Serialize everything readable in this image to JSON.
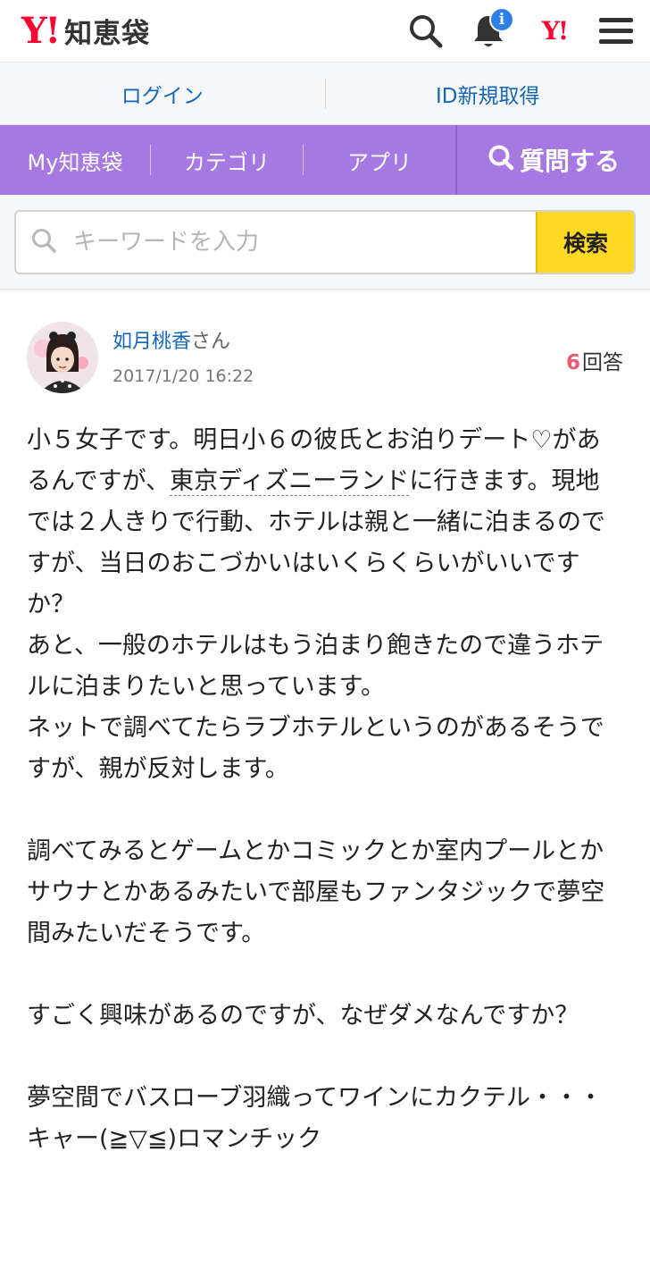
{
  "header": {
    "logo_y": "Y!",
    "logo_text": "知恵袋",
    "notification_badge": "i",
    "yj_logo": "Y!"
  },
  "loginbar": {
    "login": "ログイン",
    "register": "ID新規取得"
  },
  "nav": {
    "my": "My知恵袋",
    "category": "カテゴリ",
    "app": "アプリ",
    "ask": "質問する"
  },
  "search": {
    "placeholder": "キーワードを入力",
    "button": "検索"
  },
  "question": {
    "username": "如月桃香",
    "honorific": "さん",
    "date": "2017/1/20 16:22",
    "answer_count": "6",
    "answer_label": "回答",
    "body_part1": "小５女子です。明日小６の彼氏とお泊りデート♡があるんですが、",
    "body_link": "東京ディズニーランド",
    "body_part2": "に行きます。現地では２人きりで行動、ホテルは親と一緒に泊まるのですが、当日のおこづかいはいくらくらいがいいですか？\nあと、一般のホテルはもう泊まり飽きたので違うホテルに泊まりたいと思っています。\nネットで調べてたらラブホテルというのがあるそうですが、親が反対します。\n\n調べてみるとゲームとかコミックとか室内プールとかサウナとかあるみたいで部屋もファンタジックで夢空間みたいだそうです。\n\nすごく興味があるのですが、なぜダメなんですか？\n\n夢空間でバスローブ羽織ってワインにカクテル・・・\nキャー(≧▽≦)ロマンチック"
  },
  "colors": {
    "brand_red": "#ff0033",
    "nav_purple": "#a678e2",
    "link_blue": "#1666b8",
    "search_yellow": "#fdd923",
    "answer_count_red": "#e95a6a"
  },
  "icons": [
    "search-icon",
    "bell-icon",
    "yj-logo-icon",
    "hamburger-menu-icon",
    "search-q-icon",
    "avatar"
  ]
}
